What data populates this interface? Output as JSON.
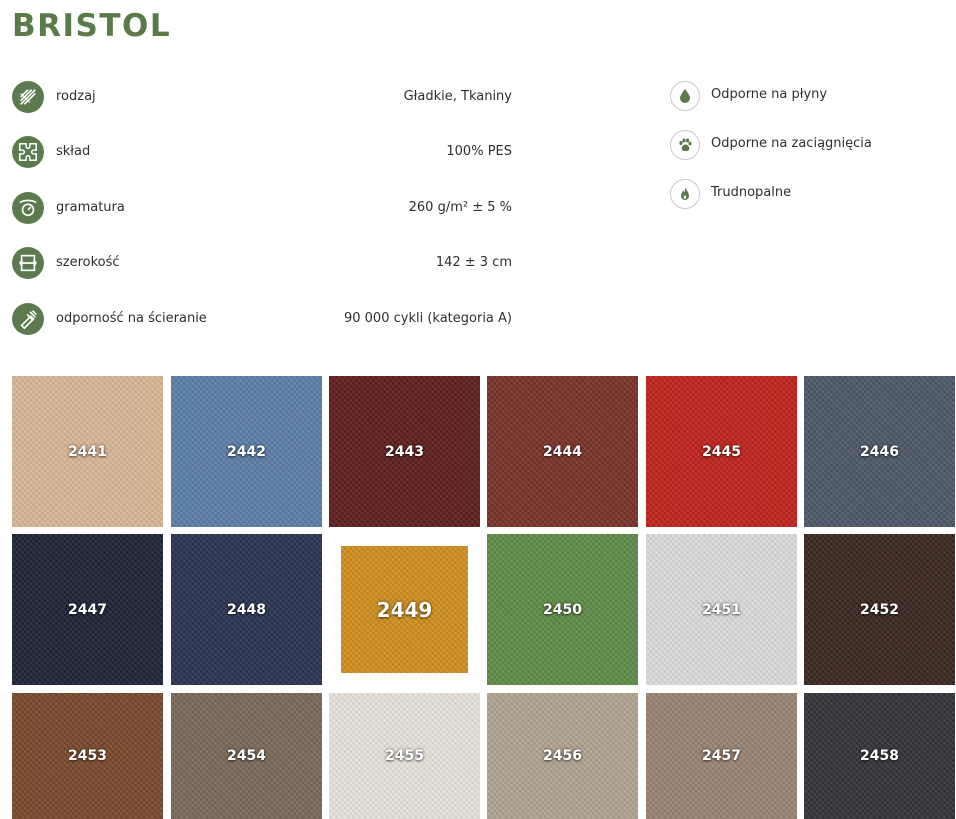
{
  "title": "BRISTOL",
  "specs": [
    {
      "label": "rodzaj",
      "value": "Gładkie, Tkaniny",
      "icon": "weave-icon"
    },
    {
      "label": "skład",
      "value": "100% PES",
      "icon": "puzzle-icon"
    },
    {
      "label": "gramatura",
      "value": "260 g/m² ± 5 %",
      "icon": "scale-icon"
    },
    {
      "label": "szerokość",
      "value": "142 ± 3 cm",
      "icon": "width-icon"
    },
    {
      "label": "odporność na ścieranie",
      "value": "90 000 cykli (kategoria A)",
      "icon": "abrasion-icon"
    }
  ],
  "features": [
    {
      "label": "Odporne na płyny",
      "icon": "droplet-icon"
    },
    {
      "label": "Odporne na zaciągnięcia",
      "icon": "paw-icon"
    },
    {
      "label": "Trudnopalne",
      "icon": "flame-icon"
    }
  ],
  "accent_color": "#5d7a4e",
  "swatches": [
    {
      "code": "2441",
      "color": "#dbb797"
    },
    {
      "code": "2442",
      "color": "#5c7fa9"
    },
    {
      "code": "2443",
      "color": "#5e1f1d"
    },
    {
      "code": "2444",
      "color": "#7a3329"
    },
    {
      "code": "2445",
      "color": "#c0231c"
    },
    {
      "code": "2446",
      "color": "#4e5868"
    },
    {
      "code": "2447",
      "color": "#1e2437"
    },
    {
      "code": "2448",
      "color": "#2a3452"
    },
    {
      "code": "2449",
      "color": "#d1901f"
    },
    {
      "code": "2450",
      "color": "#5f8c48"
    },
    {
      "code": "2451",
      "color": "#dadcde"
    },
    {
      "code": "2452",
      "color": "#3c2620"
    },
    {
      "code": "2453",
      "color": "#7b4a2d"
    },
    {
      "code": "2454",
      "color": "#7a6959"
    },
    {
      "code": "2455",
      "color": "#e8e3dc"
    },
    {
      "code": "2456",
      "color": "#b2a491"
    },
    {
      "code": "2457",
      "color": "#9a8473"
    },
    {
      "code": "2458",
      "color": "#36323a"
    }
  ]
}
